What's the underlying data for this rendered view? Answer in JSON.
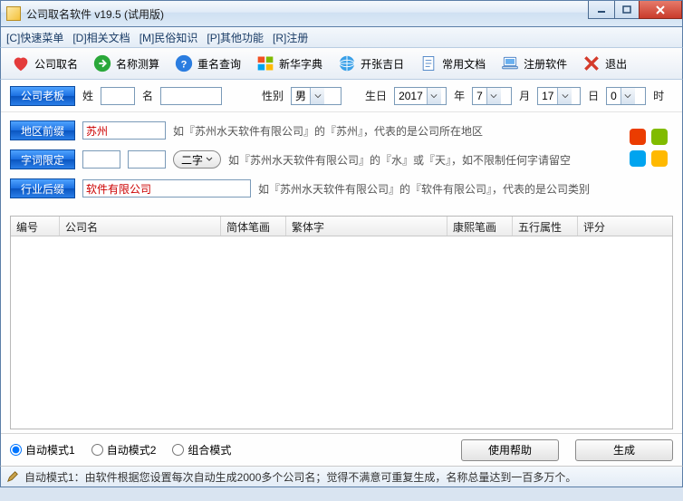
{
  "window": {
    "title": "公司取名软件 v19.5 (试用版)"
  },
  "menu": {
    "quick": "[C]快速菜单",
    "docs": "[D]相关文档",
    "folk": "[M]民俗知识",
    "other": "[P]其他功能",
    "register": "[R]注册"
  },
  "toolbar": {
    "naming": "公司取名",
    "calc": "名称测算",
    "dup": "重名查询",
    "dict": "新华字典",
    "luck": "开张吉日",
    "common": "常用文档",
    "regsoft": "注册软件",
    "exit": "退出"
  },
  "form": {
    "boss_btn": "公司老板",
    "surname_lbl": "姓",
    "surname": "",
    "given_lbl": "名",
    "given": "",
    "gender_lbl": "性别",
    "gender": "男",
    "birth_lbl": "生日",
    "year": "2017",
    "year_suf": "年",
    "month": "7",
    "month_suf": "月",
    "day": "17",
    "day_suf": "日",
    "hour": "0",
    "hour_suf": "时"
  },
  "section": {
    "prefix_btn": "地区前缀",
    "prefix_val": "苏州",
    "prefix_hint": "如『苏州水天软件有限公司』的『苏州』，代表的是公司所在地区",
    "keyword_btn": "字词限定",
    "keyword_val1": "",
    "keyword_val2": "",
    "keyword_mode": "二字",
    "keyword_hint": "如『苏州水天软件有限公司』的『水』或『天』，如不限制任何字请留空",
    "suffix_btn": "行业后缀",
    "suffix_val": "软件有限公司",
    "suffix_hint": "如『苏州水天软件有限公司』的『软件有限公司』，代表的是公司类别"
  },
  "table": {
    "cols": [
      "编号",
      "公司名",
      "简体笔画",
      "繁体字",
      "康熙笔画",
      "五行属性",
      "评分"
    ]
  },
  "bottom": {
    "mode1": "自动模式1",
    "mode2": "自动模式2",
    "mode3": "组合模式",
    "help": "使用帮助",
    "generate": "生成"
  },
  "status": {
    "text": "自动模式1：由软件根据您设置每次自动生成2000多个公司名；觉得不满意可重复生成，名称总量达到一百多万个。"
  }
}
